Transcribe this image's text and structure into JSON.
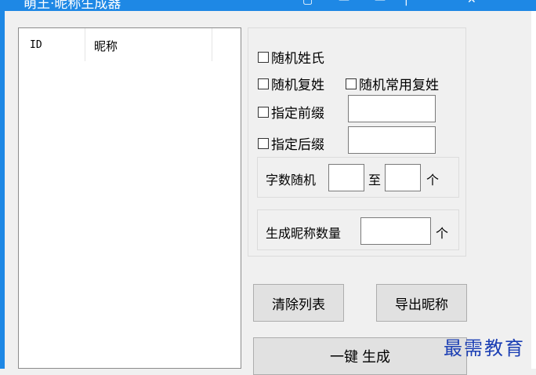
{
  "window": {
    "title": "萌王·昵称生成器"
  },
  "listview": {
    "columns": [
      "ID",
      "昵称"
    ]
  },
  "options": {
    "random_surname": "随机姓氏",
    "random_compound_surname": "随机复姓",
    "random_common_compound_surname": "随机常用复姓",
    "specify_prefix": "指定前缀",
    "specify_prefix_value": "",
    "specify_suffix": "指定后缀",
    "specify_suffix_value": ""
  },
  "char_count": {
    "label": "字数随机",
    "to_label": "至",
    "unit": "个",
    "min_value": "",
    "max_value": ""
  },
  "quantity": {
    "label": "生成昵称数量",
    "value": "",
    "unit": "个"
  },
  "buttons": {
    "clear_list": "清除列表",
    "export": "导出昵称",
    "generate": "一键 生成"
  },
  "watermark": "最需教育"
}
